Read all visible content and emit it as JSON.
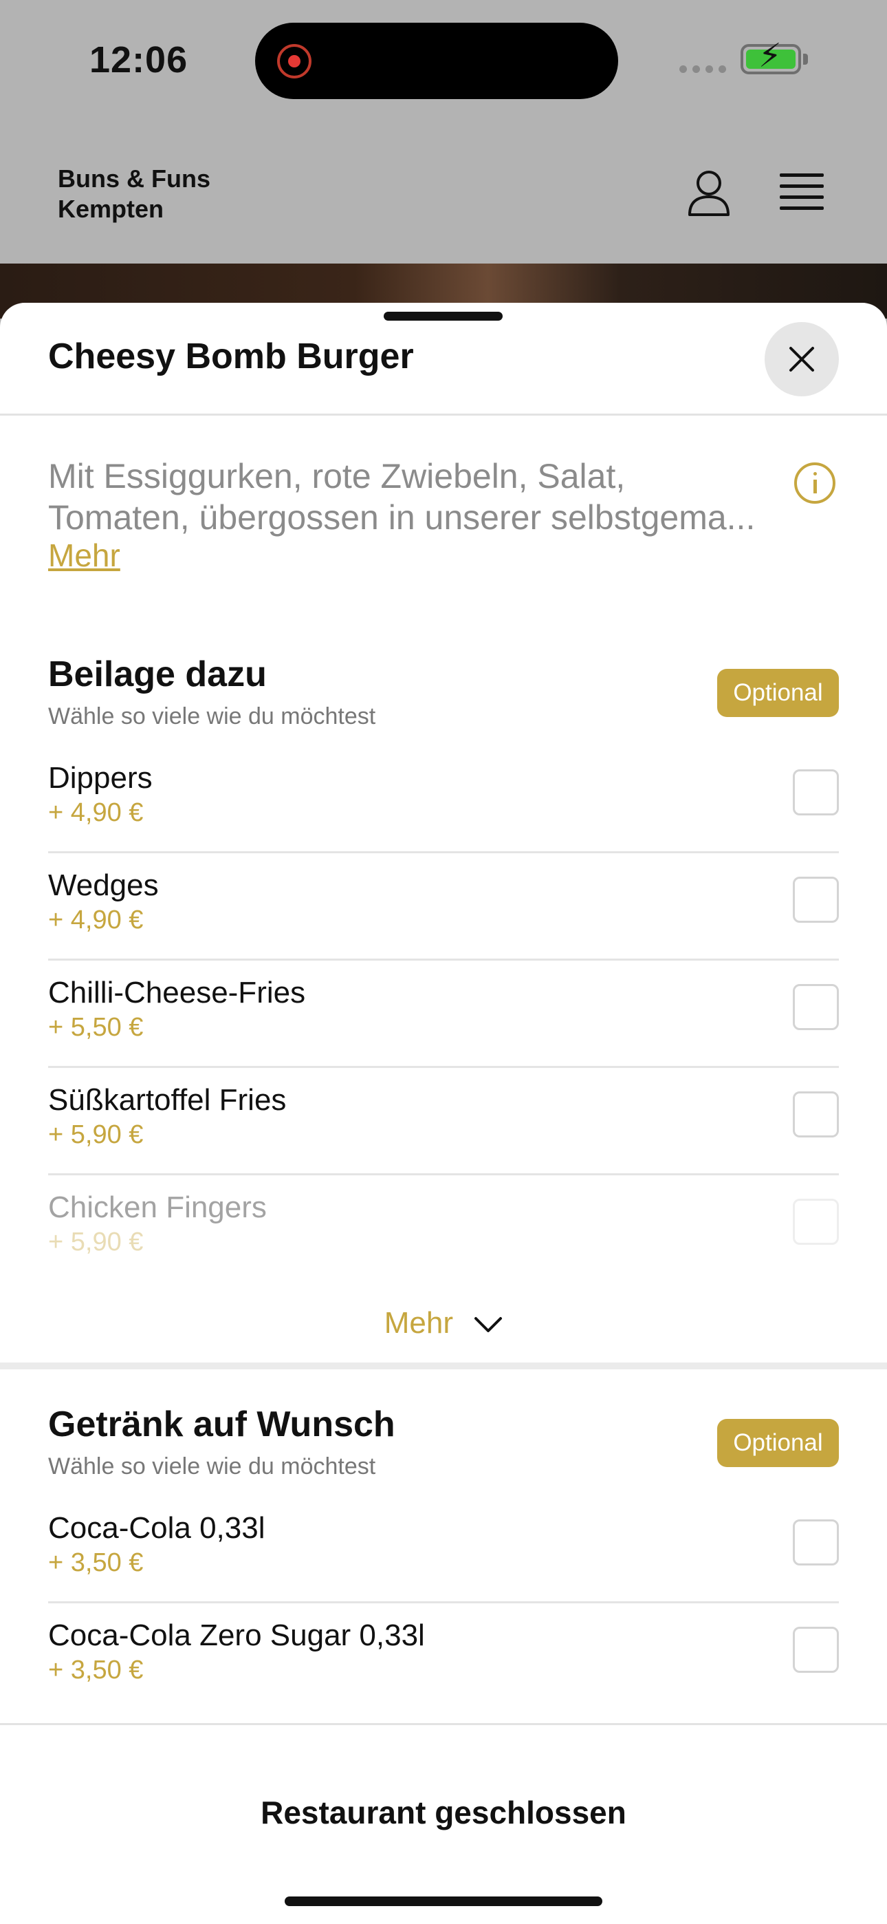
{
  "status_bar": {
    "time": "12:06",
    "battery_color": "#3ec13a"
  },
  "app_header": {
    "brand_line1": "Buns & Funs",
    "brand_line2": "Kempten"
  },
  "sheet": {
    "title": "Cheesy Bomb Burger",
    "description_line1": "Mit Essiggurken, rote Zwiebeln, Salat,",
    "description_line2": "Tomaten, übergossen in unserer selbstgema...",
    "more_label": "Mehr"
  },
  "sections": [
    {
      "title": "Beilage dazu",
      "subtitle": "Wähle so viele wie du möchtest",
      "badge": "Optional",
      "options": [
        {
          "name": "Dippers",
          "price": "+ 4,90 €"
        },
        {
          "name": "Wedges",
          "price": "+ 4,90 €"
        },
        {
          "name": "Chilli-Cheese-Fries",
          "price": "+ 5,50 €"
        },
        {
          "name": "Süßkartoffel Fries",
          "price": "+ 5,90 €"
        },
        {
          "name": "Chicken Fingers",
          "price": "+ 5,90 €"
        }
      ],
      "expand_label": "Mehr"
    },
    {
      "title": "Getränk auf Wunsch",
      "subtitle": "Wähle so viele wie du möchtest",
      "badge": "Optional",
      "options": [
        {
          "name": "Coca-Cola 0,33l",
          "price": "+ 3,50 €"
        },
        {
          "name": "Coca-Cola Zero Sugar 0,33l",
          "price": "+ 3,50 €"
        }
      ]
    }
  ],
  "footer": {
    "label": "Restaurant geschlossen"
  },
  "colors": {
    "accent": "#c6a63f",
    "text": "#111111",
    "muted": "#8b8b8b"
  }
}
